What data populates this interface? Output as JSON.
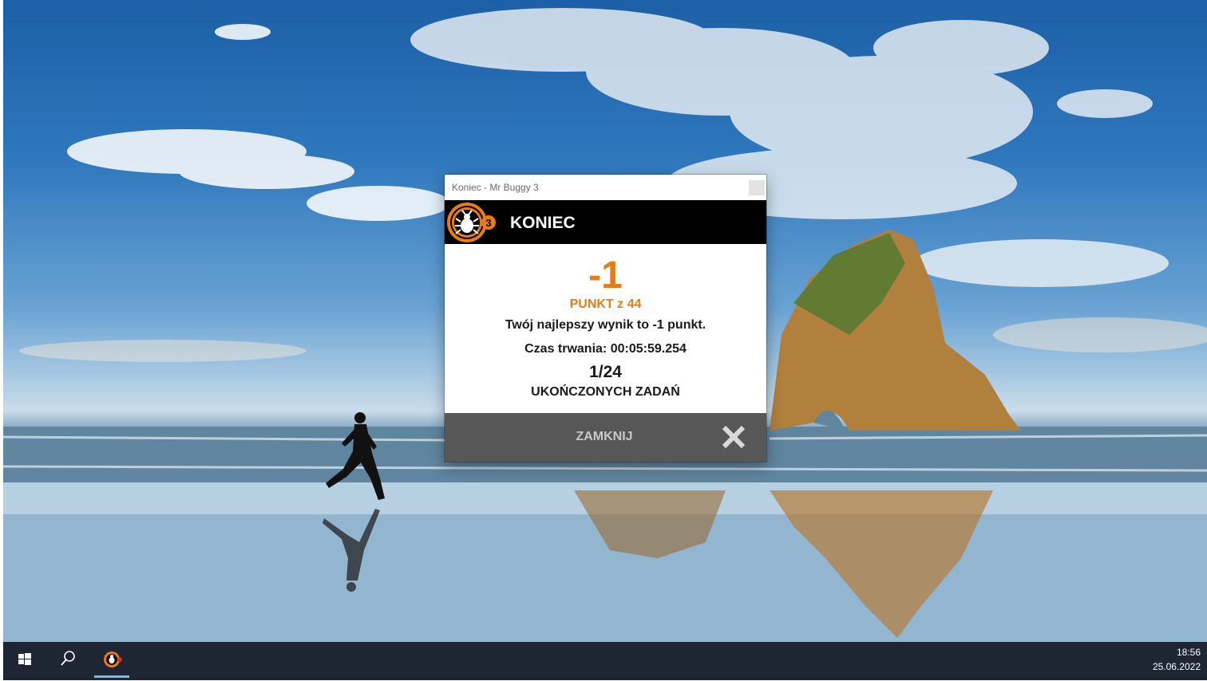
{
  "window": {
    "title": "Koniec - Mr Buggy 3"
  },
  "header": {
    "title": "KONIEC",
    "logo_icon": "mr-buggy-3-bug-logo",
    "logo_badge": "3"
  },
  "result": {
    "score": "-1",
    "score_unit": "PUNKT z 44",
    "best_score_text": "Twój najlepszy wynik to -1 punkt.",
    "duration_text": "Czas trwania: 00:05:59.254",
    "tasks_completed": "1/24",
    "tasks_label": "UKOŃCZONYCH ZADAŃ"
  },
  "footer": {
    "close_label": "ZAMKNIJ",
    "close_icon": "close-x-icon"
  },
  "taskbar": {
    "start_icon": "windows-start-icon",
    "search_icon": "search-icon",
    "app_icon": "mr-buggy-app-icon",
    "time": "18:56",
    "date": "25.06.2022"
  },
  "colors": {
    "accent": "#e87c18",
    "header_bg": "#000000",
    "footer_bg": "#575757",
    "taskbar_bg": "#1e2633"
  }
}
